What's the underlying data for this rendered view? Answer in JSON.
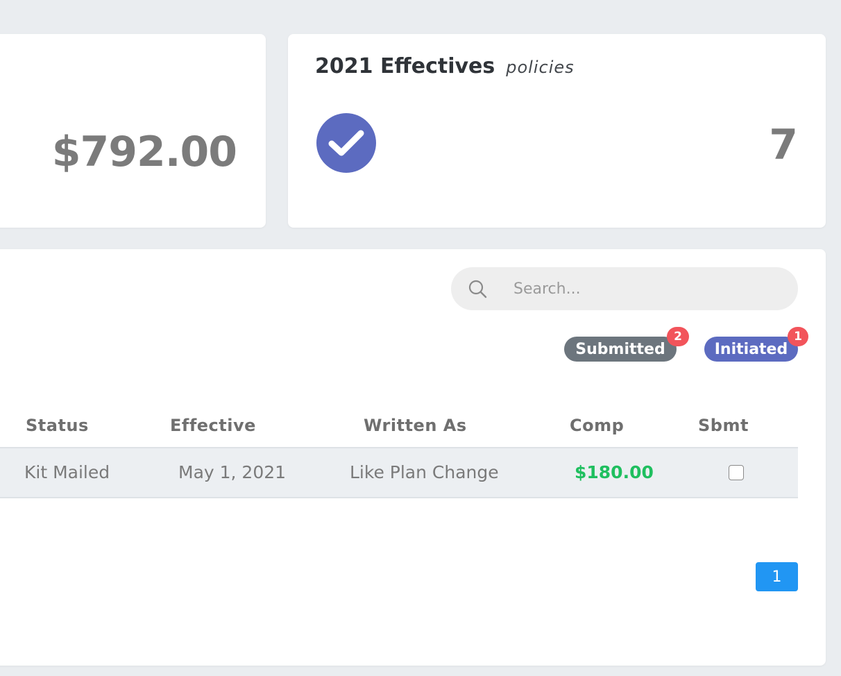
{
  "stats": {
    "premium": {
      "value": "$792.00"
    },
    "effectives": {
      "title": "2021 Effectives",
      "subtitle": "policies",
      "count": "7",
      "icon": "check-circle-icon",
      "icon_color": "#5c6bc0"
    }
  },
  "search": {
    "placeholder": "Search...",
    "value": ""
  },
  "filters": [
    {
      "label": "Submitted",
      "count": "2",
      "color": "#6c757d"
    },
    {
      "label": "Initiated",
      "count": "1",
      "color": "#5c6bc0"
    }
  ],
  "table": {
    "columns": [
      "Status",
      "Effective",
      "Written As",
      "Comp",
      "Sbmt"
    ],
    "rows": [
      {
        "status": "Kit Mailed",
        "effective": "May 1, 2021",
        "written_as": "Like Plan Change",
        "comp": "$180.00",
        "sbmt": false
      }
    ]
  },
  "pagination": {
    "current_page": "1"
  },
  "colors": {
    "background": "#eaedf0",
    "badge": "#f2545b",
    "comp_value": "#1fbf5f",
    "pagination": "#2196f3"
  }
}
